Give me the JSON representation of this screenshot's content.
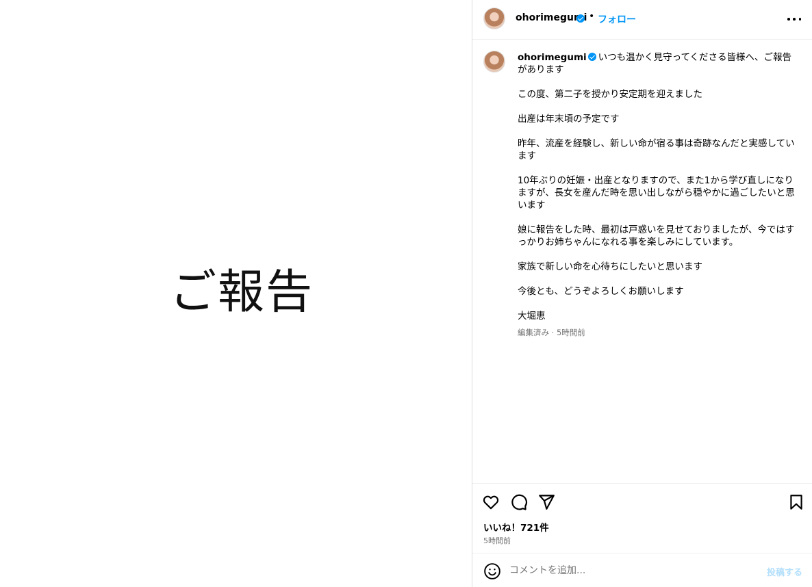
{
  "post_image": {
    "text": "ご報告"
  },
  "header": {
    "username": "ohorimegumi",
    "separator": "•",
    "follow_label": "フォロー",
    "more_icon": "more-horizontal-icon"
  },
  "caption": {
    "username": "ohorimegumi",
    "first_line": "いつも温かく見守ってくださる皆様へ、ご報告があります",
    "paragraphs": [
      "この度、第二子を授かり安定期を迎えました",
      "出産は年末頃の予定です",
      "昨年、流産を経験し、新しい命が宿る事は奇跡なんだと実感しています",
      "10年ぶりの妊娠・出産となりますので、また1から学び直しになりますが、長女を産んだ時を思い出しながら穏やかに過ごしたいと思います",
      "娘に報告をした時、最初は戸惑いを見せておりましたが、今ではすっかりお姉ちゃんになれる事を楽しみにしています。",
      "家族で新しい命を心待ちにしたいと思います",
      "今後とも、どうぞよろしくお願いします",
      "大堀恵"
    ],
    "meta": "編集済み · 5時間前"
  },
  "actions": {
    "icons": [
      "heart-icon",
      "comment-icon",
      "share-icon",
      "bookmark-icon"
    ]
  },
  "likes": "いいね！721件",
  "time": "5時間前",
  "comment_bar": {
    "placeholder": "コメントを追加...",
    "post_label": "投稿する",
    "emoji_icon": "emoji-icon"
  },
  "colors": {
    "accent": "#0095f6",
    "post_button_disabled": "#b2dffc",
    "muted_text": "#737373",
    "border": "#dbdbdb"
  }
}
